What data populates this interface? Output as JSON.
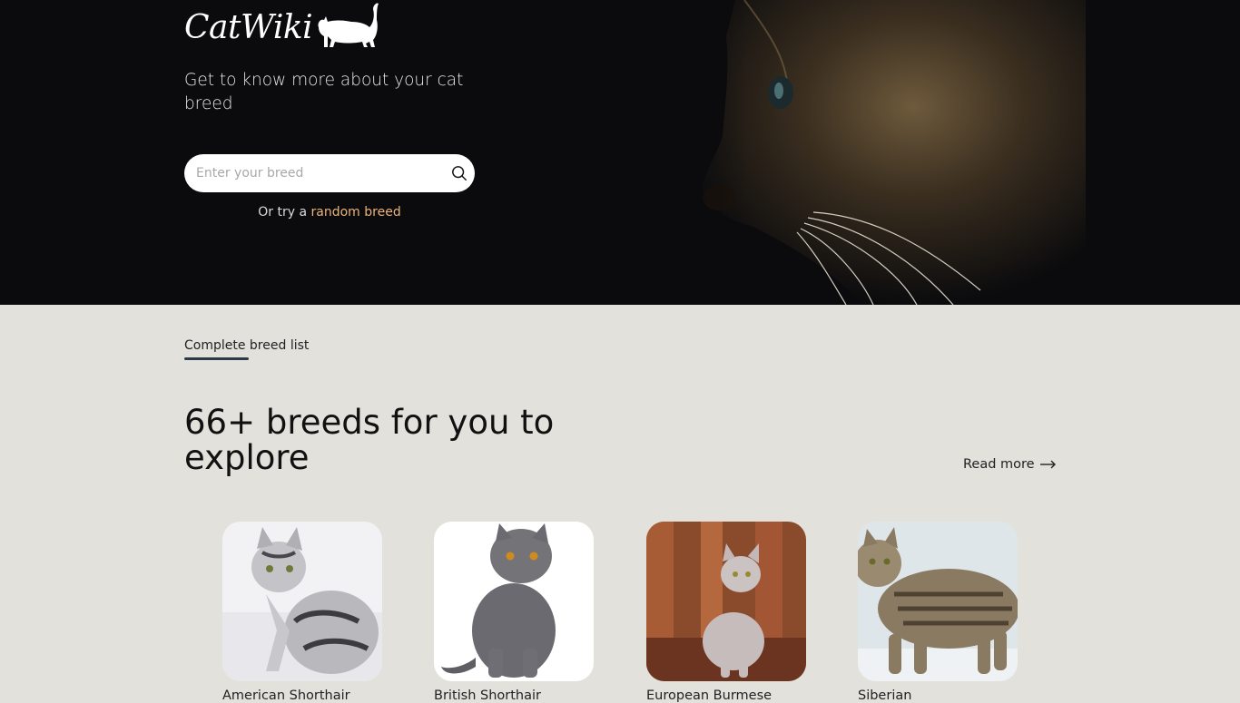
{
  "brand": {
    "name": "CatWiki"
  },
  "hero": {
    "tagline": "Get to know more about your cat breed",
    "search_placeholder": "Enter your breed",
    "random_prefix": "Or try a ",
    "random_link": "random breed"
  },
  "section": {
    "tab_label": "Complete breed list",
    "headline": "66+ breeds for you to explore",
    "read_more": "Read more",
    "breeds": [
      {
        "name": "American Shorthair"
      },
      {
        "name": "British Shorthair"
      },
      {
        "name": "European Burmese"
      },
      {
        "name": "Siberian"
      }
    ]
  },
  "colors": {
    "hero_bg": "#0b0b0d",
    "section_bg": "#e3e1dc",
    "accent_link": "#e9b37c",
    "underline": "#2d3a4a"
  },
  "icons": {
    "search": "search-icon",
    "arrow": "arrow-right-icon",
    "logo_cat": "cat-silhouette-icon"
  }
}
